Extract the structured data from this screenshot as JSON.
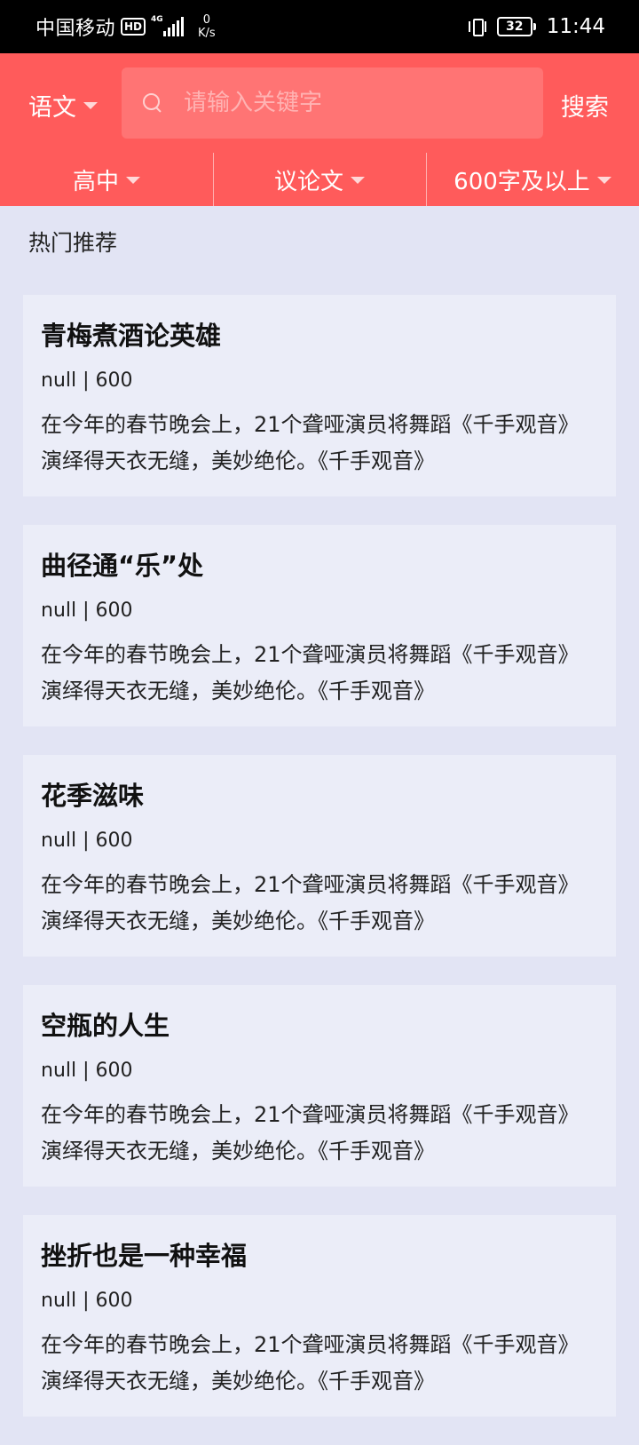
{
  "status_bar": {
    "carrier": "中国移动",
    "hd": "HD",
    "network": "4G",
    "speed_value": "0",
    "speed_unit": "K/s",
    "battery": "32",
    "time": "11:44"
  },
  "header": {
    "subject": "语文",
    "search_placeholder": "请输入关键字",
    "search_button": "搜索",
    "filters": [
      "高中",
      "议论文",
      "600字及以上"
    ]
  },
  "section_title": "热门推荐",
  "articles": [
    {
      "title": "青梅煮酒论英雄",
      "meta": "null | 600",
      "excerpt": "在今年的春节晚会上，21个聋哑演员将舞蹈《千手观音》演绎得天衣无缝，美妙绝伦。《千手观音》"
    },
    {
      "title": "曲径通“乐”处",
      "meta": "null | 600",
      "excerpt": "在今年的春节晚会上，21个聋哑演员将舞蹈《千手观音》演绎得天衣无缝，美妙绝伦。《千手观音》"
    },
    {
      "title": "花季滋味",
      "meta": "null | 600",
      "excerpt": "在今年的春节晚会上，21个聋哑演员将舞蹈《千手观音》演绎得天衣无缝，美妙绝伦。《千手观音》"
    },
    {
      "title": "空瓶的人生",
      "meta": "null | 600",
      "excerpt": "在今年的春节晚会上，21个聋哑演员将舞蹈《千手观音》演绎得天衣无缝，美妙绝伦。《千手观音》"
    },
    {
      "title": "挫折也是一种幸福",
      "meta": "null | 600",
      "excerpt": "在今年的春节晚会上，21个聋哑演员将舞蹈《千手观音》演绎得天衣无缝，美妙绝伦。《千手观音》"
    }
  ],
  "colors": {
    "header_bg": "#ff5b5b",
    "search_bg": "#ff7474",
    "page_bg": "#e2e4f4",
    "card_bg": "#ebedf8"
  }
}
